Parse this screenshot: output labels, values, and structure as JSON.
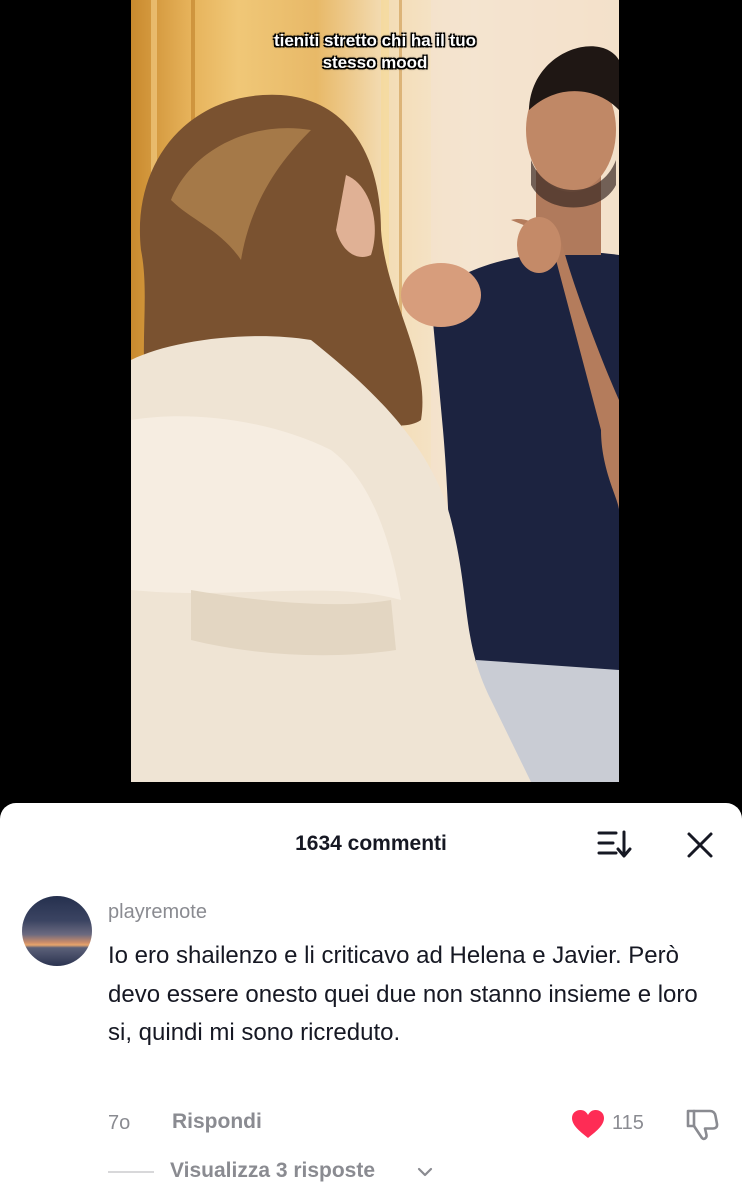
{
  "video": {
    "caption_lines": [
      "tieniti stretto chi ha il tuo",
      "stesso mood"
    ]
  },
  "comments_sheet": {
    "title": "1634 commenti",
    "sort_icon": "sort-icon",
    "close_icon": "close-icon",
    "comment": {
      "username": "playremote",
      "text": "Io ero shailenzo e li criticavo ad Helena e Javier. Però devo essere onesto quei due non stanno insieme e loro si, quindi mi sono ricreduto.",
      "time": "7o",
      "reply_label": "Rispondi",
      "like_icon": "heart-icon",
      "like_color": "#fe2c55",
      "like_count": "115",
      "dislike_icon": "thumbs-down-icon",
      "view_replies_label": "Visualizza 3 risposte"
    }
  }
}
